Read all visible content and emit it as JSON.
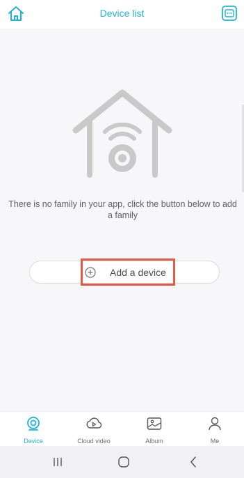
{
  "header": {
    "title": "Device list",
    "home_icon": "home-icon",
    "scan_icon": "scan-icon"
  },
  "empty_state": {
    "illustration_icon": "house-wifi-icon",
    "message": "There is no family in your app, click the button below to add a family",
    "add_button_label": "Add a device",
    "add_button_icon": "plus-circle-icon"
  },
  "tabs": [
    {
      "label": "Device",
      "icon": "camera-icon",
      "active": true
    },
    {
      "label": "Cloud video",
      "icon": "cloud-play-icon",
      "active": false
    },
    {
      "label": "Album",
      "icon": "image-icon",
      "active": false
    },
    {
      "label": "Me",
      "icon": "person-icon",
      "active": false
    }
  ],
  "navbar": {
    "recent_icon": "recent-apps-icon",
    "home_icon": "home-circle-icon",
    "back_icon": "back-icon"
  },
  "colors": {
    "accent": "#1fb3d6",
    "highlight": "#e05a45",
    "illustration": "#c9c9c9"
  }
}
